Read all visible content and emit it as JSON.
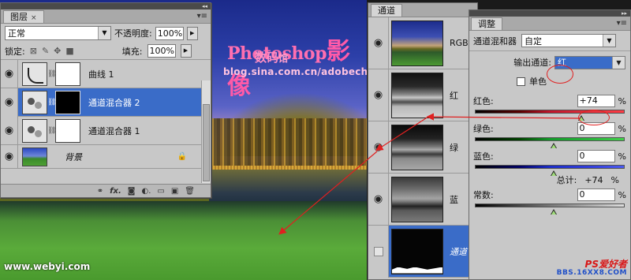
{
  "photo": {
    "watermark_title": "Photoshop",
    "watermark_big": "影像",
    "watermark_sub": "数码",
    "watermark_tail": "馆",
    "watermark_url": "blog.sina.com.cn/adobech",
    "bottom_left_url": "www.webyi.com"
  },
  "layers_panel": {
    "tab_label": "图层",
    "close_glyph": "×",
    "blend_mode": "正常",
    "opacity_label": "不透明度:",
    "opacity_value": "100%",
    "lock_label": "锁定:",
    "fill_label": "填充:",
    "fill_value": "100%",
    "layers": [
      {
        "name": "曲线 1",
        "type": "curves",
        "selected": false
      },
      {
        "name": "通道混合器 2",
        "type": "mixer",
        "selected": true
      },
      {
        "name": "通道混合器 1",
        "type": "mixer",
        "selected": false
      },
      {
        "name": "背景",
        "type": "background",
        "selected": false
      }
    ],
    "footer_icons": [
      "link-icon",
      "fx-icon",
      "mask-icon",
      "adjustment-icon",
      "folder-icon",
      "new-layer-icon",
      "trash-icon"
    ]
  },
  "channels_panel": {
    "tab_label": "通道",
    "channels": [
      {
        "name": "RGB",
        "visible": true
      },
      {
        "name": "红",
        "visible": true
      },
      {
        "name": "绿",
        "visible": true
      },
      {
        "name": "蓝",
        "visible": true
      },
      {
        "name": "通道",
        "visible": false
      }
    ]
  },
  "adjust_panel": {
    "tab_label": "调整",
    "title": "通道混和器",
    "preset_value": "自定",
    "output_channel_label": "输出通道:",
    "output_channel_value": "红",
    "monochrome_label": "单色",
    "red_label": "红色:",
    "red_value": "+74",
    "green_label": "绿色:",
    "green_value": "0",
    "blue_label": "蓝色:",
    "blue_value": "0",
    "total_label": "总计:",
    "total_value": "+74",
    "constant_label": "常数:",
    "constant_value": "0",
    "percent": "%",
    "watermark_ps": "PS爱好者",
    "watermark_site": "BBS.16XX8.COM"
  },
  "colors": {
    "selection_blue": "#3a6cc8",
    "panel_gray": "#c8c8c8",
    "annotation_red": "#e02020"
  }
}
